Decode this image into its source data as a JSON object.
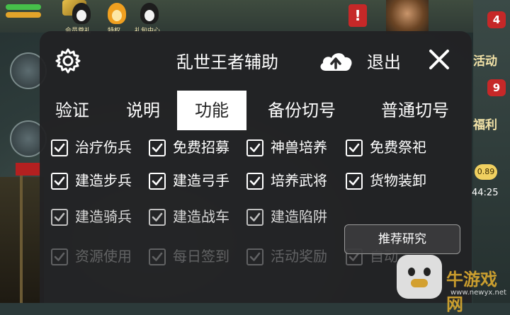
{
  "game": {
    "top_labels": [
      "会员尊礼",
      "特权",
      "礼包中心"
    ],
    "alert_badge": "!",
    "right_badges": [
      "4",
      "9"
    ],
    "right_labels": [
      "活动",
      "福利"
    ],
    "percent_badge": "0.89",
    "timer": "44:25"
  },
  "watermark": {
    "brand": "牛游戏网",
    "url": "www.newyx.net"
  },
  "dialog": {
    "title": "乱世王者辅助",
    "logout_label": "退出",
    "icons": {
      "settings": "gear-icon",
      "upload": "cloud-upload-icon",
      "close": "close-icon"
    },
    "tabs": [
      {
        "label": "验证",
        "active": false
      },
      {
        "label": "说明",
        "active": false
      },
      {
        "label": "功能",
        "active": true
      },
      {
        "label": "备份切号",
        "active": false
      },
      {
        "label": "普通切号",
        "active": false
      }
    ],
    "options": [
      {
        "label": "治疗伤兵",
        "checked": true
      },
      {
        "label": "免费招募",
        "checked": true
      },
      {
        "label": "神兽培养",
        "checked": true
      },
      {
        "label": "免费祭祀",
        "checked": true
      },
      {
        "label": "建造步兵",
        "checked": true
      },
      {
        "label": "建造弓手",
        "checked": true
      },
      {
        "label": "培养武将",
        "checked": true
      },
      {
        "label": "货物装卸",
        "checked": true
      },
      {
        "label": "建造骑兵",
        "checked": true
      },
      {
        "label": "建造战车",
        "checked": true
      },
      {
        "label": "建造陷阱",
        "checked": true
      },
      {
        "label": "资源使用",
        "checked": true
      },
      {
        "label": "每日签到",
        "checked": true
      },
      {
        "label": "活动奖励",
        "checked": true
      },
      {
        "label": "自动",
        "checked": true
      }
    ],
    "research_button": "推荐研究"
  }
}
